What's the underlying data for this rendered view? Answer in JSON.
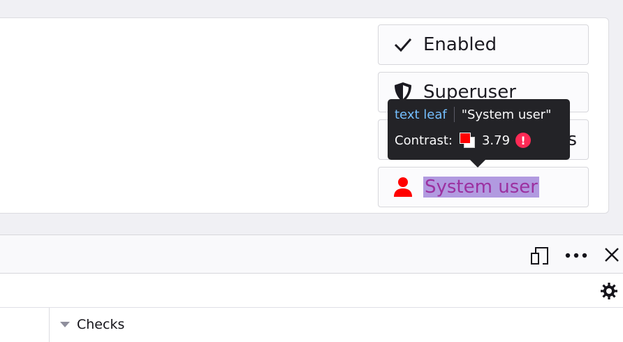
{
  "badges": [
    {
      "label": "Enabled",
      "icon": "checkmark-icon"
    },
    {
      "label": "Superuser",
      "icon": "shield-icon"
    },
    {
      "label": "s",
      "icon": "none"
    },
    {
      "label": "System user",
      "icon": "user-icon"
    }
  ],
  "tooltip": {
    "tag": "text leaf",
    "text": "\"System user\"",
    "contrast_label": "Contrast:",
    "contrast_value": "3.79",
    "foreground_color": "#ff0000",
    "background_color": "#ffffff",
    "warning_icon": "exclamation-icon"
  },
  "toolbar": {
    "icons": [
      "responsive-design-icon",
      "more-options-icon",
      "close-icon"
    ]
  },
  "settings": {
    "icon": "gear-icon"
  },
  "panel": {
    "section_label": "Checks"
  },
  "colors": {
    "highlight": "#b19ae0",
    "user_icon": "#ff0000",
    "tooltip_bg": "#232327",
    "warning": "#ff2a55"
  }
}
